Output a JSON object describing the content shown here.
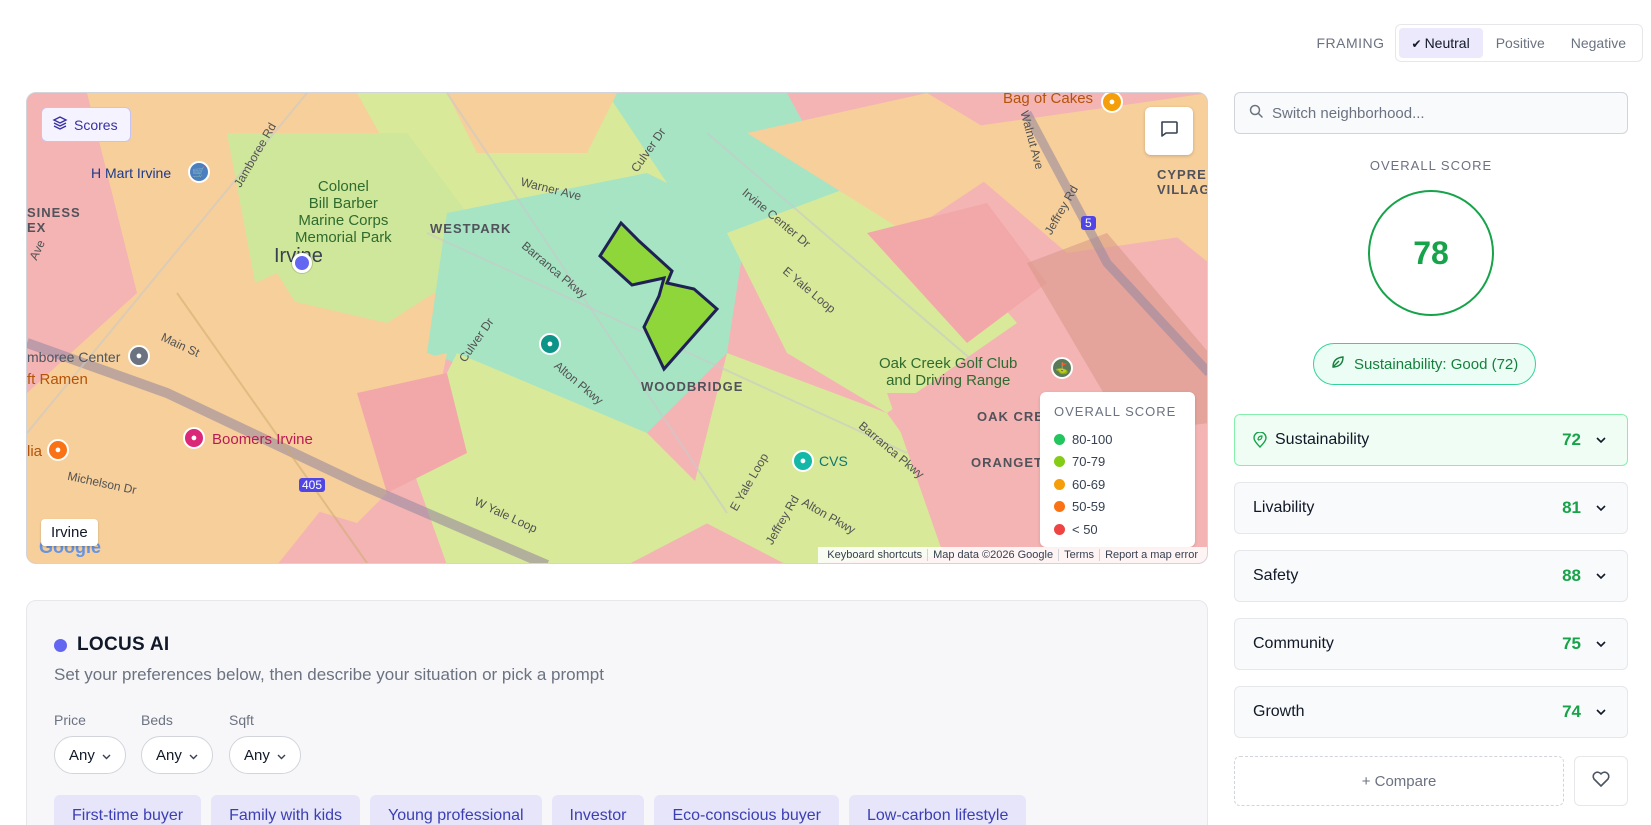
{
  "framing": {
    "label": "FRAMING",
    "options": [
      {
        "label": "Neutral",
        "active": true
      },
      {
        "label": "Positive",
        "active": false
      },
      {
        "label": "Negative",
        "active": false
      }
    ]
  },
  "map": {
    "scores_button": "Scores",
    "city_chip": "Irvine",
    "legend": {
      "title": "OVERALL SCORE",
      "items": [
        {
          "label": "80-100",
          "color": "#22c55e"
        },
        {
          "label": "70-79",
          "color": "#84cc16"
        },
        {
          "label": "60-69",
          "color": "#f59e0b"
        },
        {
          "label": "50-59",
          "color": "#f97316"
        },
        {
          "label": "< 50",
          "color": "#ef4444"
        }
      ]
    },
    "attribution": {
      "shortcuts": "Keyboard shortcuts",
      "data": "Map data ©2026 Google",
      "terms": "Terms",
      "report": "Report a map error"
    },
    "labels": {
      "irvine": "Irvine",
      "hmart": "H Mart Irvine",
      "park": "Colonel\nBill Barber\nMarine Corps\nMemorial Park",
      "westpark": "WESTPARK",
      "woodbridge": "WOODBRIDGE",
      "warner": "Warner Ave",
      "culver1": "Culver Dr",
      "culver2": "Culver Dr",
      "barranca1": "Barranca Pkwy",
      "barranca2": "Barranca Pkwy",
      "alton1": "Alton Pkwy",
      "alton2": "Alton Pkwy",
      "yale_loop1": "E Yale Loop",
      "yale_loop2": "E Yale Loop",
      "w_yale": "W Yale Loop",
      "irvine_center": "Irvine Center Dr",
      "main": "Main St",
      "michelson": "Michelson Dr",
      "jamboree": "Jamboree Rd",
      "jeffrey1": "Jeffrey Rd",
      "jeffrey2": "Jeffrey Rd",
      "walnut": "Walnut Ave",
      "bag_of_cakes": "Bag of Cakes",
      "golf": "Oak Creek Golf Club\nand Driving Range",
      "oak_creek": "OAK CRE",
      "orangetree": "ORANGET",
      "cvs": "CVS",
      "boomers": "Boomers Irvine",
      "jamboree_center": "mboree Center",
      "ramen": "ft Ramen",
      "business": "SINESS\nEX",
      "cypress": "CYPRES\nVILLAG",
      "ave_left": "Ave",
      "lia": "lia",
      "shield_5": "5",
      "shield_405": "405"
    }
  },
  "sidebar": {
    "search_placeholder": "Switch neighborhood...",
    "overall_label": "OVERALL SCORE",
    "overall_score": "78",
    "sustainability_badge": "Sustainability: Good (72)",
    "categories": [
      {
        "name": "Sustainability",
        "score": "72",
        "icon": "leaf-pin-icon"
      },
      {
        "name": "Livability",
        "score": "81"
      },
      {
        "name": "Safety",
        "score": "88"
      },
      {
        "name": "Community",
        "score": "75"
      },
      {
        "name": "Growth",
        "score": "74"
      }
    ],
    "compare_label": "+ Compare",
    "accent": "#16a34a"
  },
  "ai": {
    "title": "LOCUS AI",
    "subtitle": "Set your preferences below, then describe your situation or pick a prompt",
    "filters": [
      {
        "label": "Price",
        "value": "Any"
      },
      {
        "label": "Beds",
        "value": "Any"
      },
      {
        "label": "Sqft",
        "value": "Any"
      }
    ],
    "chips": [
      "First-time buyer",
      "Family with kids",
      "Young professional",
      "Investor",
      "Eco-conscious buyer",
      "Low-carbon lifestyle"
    ],
    "accent": "#6366f1"
  }
}
